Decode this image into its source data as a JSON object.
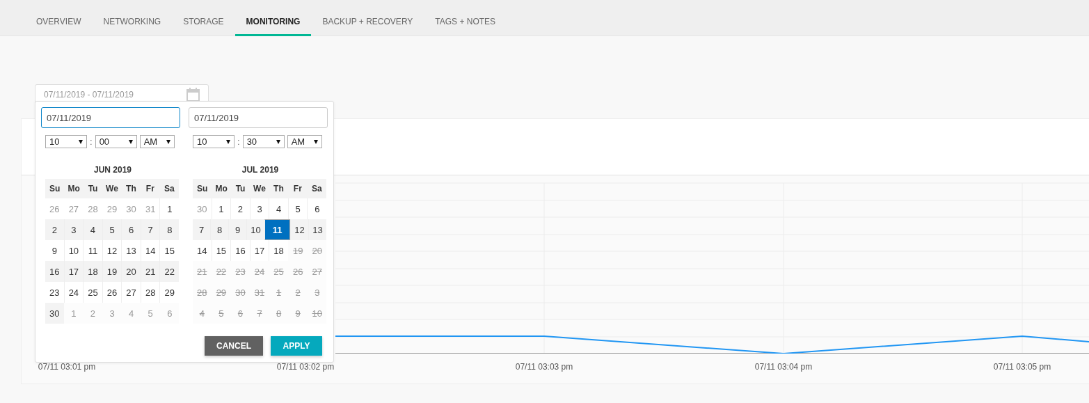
{
  "tabs": [
    {
      "label": "OVERVIEW",
      "selected": false
    },
    {
      "label": "NETWORKING",
      "selected": false
    },
    {
      "label": "STORAGE",
      "selected": false
    },
    {
      "label": "MONITORING",
      "selected": true
    },
    {
      "label": "BACKUP + RECOVERY",
      "selected": false
    },
    {
      "label": "TAGS + NOTES",
      "selected": false
    }
  ],
  "date_range": {
    "value": "07/11/2019 - 07/11/2019"
  },
  "picker": {
    "ranges": [
      {
        "value": "07/11/2019",
        "focused": true,
        "hour": "10",
        "minute": "00",
        "ampm": "AM",
        "separator": ":"
      },
      {
        "value": "07/11/2019",
        "focused": false,
        "hour": "10",
        "minute": "30",
        "ampm": "AM",
        "separator": ":"
      }
    ],
    "months": [
      {
        "title": "JUN 2019",
        "weekdays": [
          "Su",
          "Mo",
          "Tu",
          "We",
          "Th",
          "Fr",
          "Sa"
        ],
        "days": [
          {
            "label": "26",
            "kind": "other",
            "selected": false
          },
          {
            "label": "27",
            "kind": "other",
            "selected": false
          },
          {
            "label": "28",
            "kind": "other",
            "selected": false
          },
          {
            "label": "29",
            "kind": "other",
            "selected": false
          },
          {
            "label": "30",
            "kind": "other",
            "selected": false
          },
          {
            "label": "31",
            "kind": "other",
            "selected": false
          },
          {
            "label": "1",
            "kind": "day",
            "selected": false
          },
          {
            "label": "2",
            "kind": "day",
            "selected": false
          },
          {
            "label": "3",
            "kind": "day",
            "selected": false
          },
          {
            "label": "4",
            "kind": "day",
            "selected": false
          },
          {
            "label": "5",
            "kind": "day",
            "selected": false
          },
          {
            "label": "6",
            "kind": "day",
            "selected": false
          },
          {
            "label": "7",
            "kind": "day",
            "selected": false
          },
          {
            "label": "8",
            "kind": "day",
            "selected": false
          },
          {
            "label": "9",
            "kind": "day",
            "selected": false
          },
          {
            "label": "10",
            "kind": "day",
            "selected": false
          },
          {
            "label": "11",
            "kind": "day",
            "selected": false
          },
          {
            "label": "12",
            "kind": "day",
            "selected": false
          },
          {
            "label": "13",
            "kind": "day",
            "selected": false
          },
          {
            "label": "14",
            "kind": "day",
            "selected": false
          },
          {
            "label": "15",
            "kind": "day",
            "selected": false
          },
          {
            "label": "16",
            "kind": "day",
            "selected": false
          },
          {
            "label": "17",
            "kind": "day",
            "selected": false
          },
          {
            "label": "18",
            "kind": "day",
            "selected": false
          },
          {
            "label": "19",
            "kind": "day",
            "selected": false
          },
          {
            "label": "20",
            "kind": "day",
            "selected": false
          },
          {
            "label": "21",
            "kind": "day",
            "selected": false
          },
          {
            "label": "22",
            "kind": "day",
            "selected": false
          },
          {
            "label": "23",
            "kind": "day",
            "selected": false
          },
          {
            "label": "24",
            "kind": "day",
            "selected": false
          },
          {
            "label": "25",
            "kind": "day",
            "selected": false
          },
          {
            "label": "26",
            "kind": "day",
            "selected": false
          },
          {
            "label": "27",
            "kind": "day",
            "selected": false
          },
          {
            "label": "28",
            "kind": "day",
            "selected": false
          },
          {
            "label": "29",
            "kind": "day",
            "selected": false
          },
          {
            "label": "30",
            "kind": "day",
            "selected": false
          },
          {
            "label": "1",
            "kind": "other",
            "selected": false
          },
          {
            "label": "2",
            "kind": "other",
            "selected": false
          },
          {
            "label": "3",
            "kind": "other",
            "selected": false
          },
          {
            "label": "4",
            "kind": "other",
            "selected": false
          },
          {
            "label": "5",
            "kind": "other",
            "selected": false
          },
          {
            "label": "6",
            "kind": "other",
            "selected": false
          }
        ]
      },
      {
        "title": "JUL 2019",
        "weekdays": [
          "Su",
          "Mo",
          "Tu",
          "We",
          "Th",
          "Fr",
          "Sa"
        ],
        "days": [
          {
            "label": "30",
            "kind": "other",
            "selected": false
          },
          {
            "label": "1",
            "kind": "day",
            "selected": false
          },
          {
            "label": "2",
            "kind": "day",
            "selected": false
          },
          {
            "label": "3",
            "kind": "day",
            "selected": false
          },
          {
            "label": "4",
            "kind": "day",
            "selected": false
          },
          {
            "label": "5",
            "kind": "day",
            "selected": false
          },
          {
            "label": "6",
            "kind": "day",
            "selected": false
          },
          {
            "label": "7",
            "kind": "day",
            "selected": false
          },
          {
            "label": "8",
            "kind": "day",
            "selected": false
          },
          {
            "label": "9",
            "kind": "day",
            "selected": false
          },
          {
            "label": "10",
            "kind": "day",
            "selected": false
          },
          {
            "label": "11",
            "kind": "day",
            "selected": true
          },
          {
            "label": "12",
            "kind": "day",
            "selected": false
          },
          {
            "label": "13",
            "kind": "day",
            "selected": false
          },
          {
            "label": "14",
            "kind": "day",
            "selected": false
          },
          {
            "label": "15",
            "kind": "day",
            "selected": false
          },
          {
            "label": "16",
            "kind": "day",
            "selected": false
          },
          {
            "label": "17",
            "kind": "day",
            "selected": false
          },
          {
            "label": "18",
            "kind": "day",
            "selected": false
          },
          {
            "label": "19",
            "kind": "disabled",
            "selected": false
          },
          {
            "label": "20",
            "kind": "disabled",
            "selected": false
          },
          {
            "label": "21",
            "kind": "disabled",
            "selected": false
          },
          {
            "label": "22",
            "kind": "disabled",
            "selected": false
          },
          {
            "label": "23",
            "kind": "disabled",
            "selected": false
          },
          {
            "label": "24",
            "kind": "disabled",
            "selected": false
          },
          {
            "label": "25",
            "kind": "disabled",
            "selected": false
          },
          {
            "label": "26",
            "kind": "disabled",
            "selected": false
          },
          {
            "label": "27",
            "kind": "disabled",
            "selected": false
          },
          {
            "label": "28",
            "kind": "disabled",
            "selected": false
          },
          {
            "label": "29",
            "kind": "disabled",
            "selected": false
          },
          {
            "label": "30",
            "kind": "disabled",
            "selected": false
          },
          {
            "label": "31",
            "kind": "disabled",
            "selected": false
          },
          {
            "label": "1",
            "kind": "disabled",
            "selected": false
          },
          {
            "label": "2",
            "kind": "disabled",
            "selected": false
          },
          {
            "label": "3",
            "kind": "disabled",
            "selected": false
          },
          {
            "label": "4",
            "kind": "disabled",
            "selected": false
          },
          {
            "label": "5",
            "kind": "disabled",
            "selected": false
          },
          {
            "label": "6",
            "kind": "disabled",
            "selected": false
          },
          {
            "label": "7",
            "kind": "disabled",
            "selected": false
          },
          {
            "label": "8",
            "kind": "disabled",
            "selected": false
          },
          {
            "label": "9",
            "kind": "disabled",
            "selected": false
          },
          {
            "label": "10",
            "kind": "disabled",
            "selected": false
          }
        ]
      }
    ],
    "buttons": [
      {
        "label": "CANCEL",
        "kind": "cancel"
      },
      {
        "label": "APPLY",
        "kind": "apply"
      }
    ]
  },
  "chart": {
    "x_labels": [
      "07/11 03:01 pm",
      "07/11 03:02 pm",
      "07/11 03:03 pm",
      "07/11 03:04 pm",
      "07/11 03:05 pm"
    ]
  }
}
